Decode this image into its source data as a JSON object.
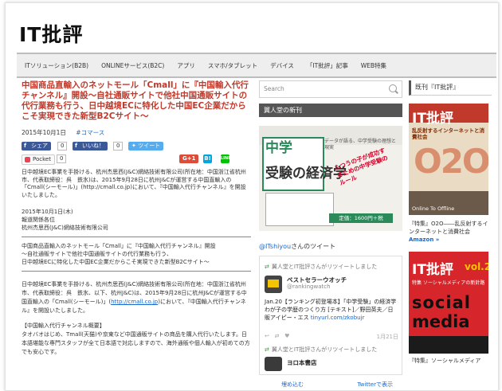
{
  "logo": "IT批評",
  "nav": [
    "ITソリューション(B2B)",
    "ONLINEサービス(B2C)",
    "アプリ",
    "スマホ/タブレット",
    "デバイス",
    "「IT批評」記事",
    "WEB特集"
  ],
  "article": {
    "title": "中国商品直輸入のネットモール「Cmall」に『中国輸入代行チャンネル』開設〜自社通販サイトで他社中国通販サイトの代行業務も行う、日中越境ECに特化した中国EC企業だからこそ実現できた新型B2Cサイト〜",
    "date": "2015年10月1日",
    "tag": "#コマース",
    "share": {
      "fb_share": "シェア",
      "fb_share_count": "0",
      "fb_like": "いいね！",
      "fb_like_count": "0",
      "tweet": "ツイート",
      "pocket": "Pocket",
      "pocket_count": "0",
      "gplus": "G+1",
      "hatena": "B!",
      "line": "LINE"
    },
    "lead": "日中越境EC事業を手掛ける、杭州杰思西(J&C)網絡技術有限公司(所在地：中国浙江省杭州市、代表取締役：呉　鉄氷)は、2015年9月28日に杭州J&Cが運営する中国直輸入の「Cmall(シーモール)」(http://cmall.co.jp)において、『中国輸入代行チャンネル』を開設いたしました。",
    "release": [
      "2015年10月1日(木)",
      "報道関係各位",
      "杭州杰思西(J&C)網絡技術有限公司"
    ],
    "quote": [
      "中国商品直輸入のネットモール「Cmall」に『中国輸入代行チャンネル』開設",
      "〜自社通販サイトで他社中国通販サイトの代行業務も行う、",
      "日中越境ECに特化した中国EC企業だからこそ実現できた新型B2Cサイト〜"
    ],
    "body_pre": "日中越境EC事業を手掛ける、杭州杰思西(J&C)網絡技術有限公司(所在地：中国浙江省杭州市、代表取締役：呉　鉄氷、以下、杭州J&C)は、2015年9月28日に杭州J&Cが運営する中国直輸入の「Cmall(シーモール)」(",
    "body_link": "http://cmall.co.jp",
    "body_post": ")において、『中国輸入代行チャンネル』を開設いたしました。",
    "section_head": "【中国輸入代行チャンネル概要】",
    "section_body": "タオバオはじめ、Tmall(天猫)や京東など中国通販サイトの商品を購入代行いたします。日本語堪能な専門スタッフが全て日本語で対応しますので、海外通販や個人輸入が初めての方でも安心です。"
  },
  "middle": {
    "search_placeholder": "Search",
    "shelf_title": "翼人堂の新刊",
    "book": {
      "line1": "中学",
      "line2": "受験の経済学",
      "note": "データが語る、中学受験の理想と現実",
      "red": "ふつうの子が成功するための中学受験のルール",
      "price": "定価：1600円＋税"
    },
    "tweets_label_user": "@ITshiyou",
    "tweets_label_rest": "さんのツイート",
    "retweet1": "翼人堂とIT批評さんがリツイートしました",
    "tweet_name": "ベストセラーウオッチ",
    "tweet_handle": "@rankingwatch",
    "tweet_body": "Jan.20【ランキング初登場本】「中学受験」の経済学 わが子の学歴のつくり方 [テキスト]／野田英夫／日販アイピー・エス",
    "tweet_link": "tinyurl.com/zkobujr",
    "tweet_date": "1月21日",
    "retweet2": "翼人堂とIT批評さんがリツイートしました",
    "tweet2_name": "ヨロ本書店",
    "embed": "埋め込む",
    "view": "Twitterで表示"
  },
  "sidebar": {
    "title": "既刊『IT批評』",
    "cover1": {
      "brand": "IT批評",
      "sub": "乱反射するインターネットと消費社会",
      "big": "O2O",
      "online": "Online To Offline"
    },
    "caption1": "『特集』O2O――乱反射するインターネットと消費社会 ",
    "caption1_more": "Amazon »",
    "cover2": {
      "brand": "IT批評",
      "vol": "vol.2",
      "sub": "特集 ソーシャルメディアの新針路",
      "big1": "social",
      "big2": "media"
    },
    "caption2": "『特集』ソーシャルメディア"
  },
  "colors": {
    "accent_red": "#c0392b",
    "link_blue": "#1a67c9",
    "facebook": "#3b5998",
    "twitter": "#55acee"
  }
}
